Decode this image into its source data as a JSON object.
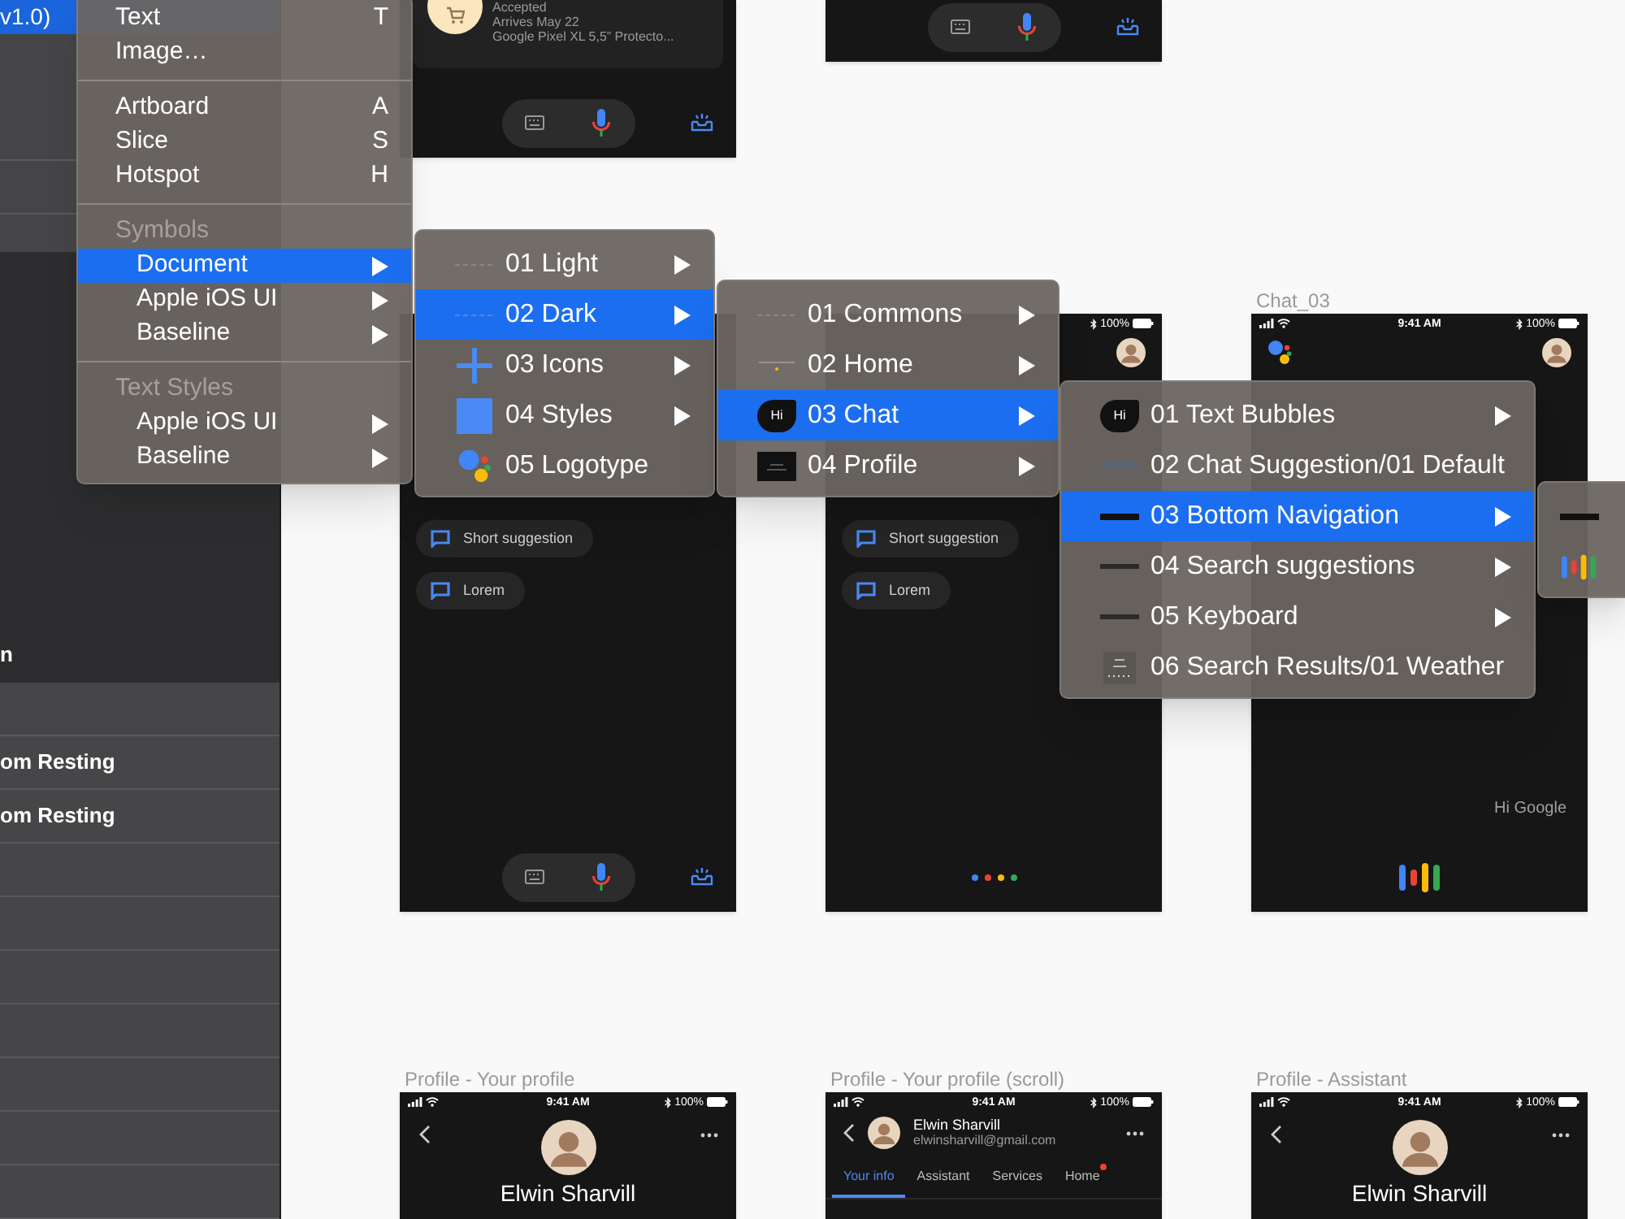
{
  "sidebar": {
    "selected_item": {
      "label": "v1.0)",
      "selected": true
    },
    "partial_label": "n",
    "rows": [
      {
        "label": "om Resting"
      },
      {
        "label": "om Resting"
      }
    ]
  },
  "artboards": [
    {
      "kind": "order",
      "order": {
        "status": "Accepted",
        "arrival": "Arrives May 22",
        "product": "Google Pixel XL 5,5” Protecto..."
      },
      "footer": {
        "kind": "input_bar"
      }
    },
    {
      "kind": "blank",
      "footer": {
        "kind": "input_bar"
      }
    },
    {
      "kind": "chat",
      "avatar": false,
      "chips": [
        "Short suggestion",
        "Lorem"
      ],
      "footer": {
        "kind": "input_bar"
      }
    },
    {
      "kind": "chat",
      "battery": "100%",
      "avatar": true,
      "chips": [
        "Short suggestion",
        "Lorem"
      ],
      "footer": {
        "kind": "dots"
      }
    },
    {
      "kind": "chat",
      "title": "Chat_03",
      "time": "9:41 AM",
      "battery": "100%",
      "avatar": true,
      "greeting": "Hi Google",
      "footer": {
        "kind": "bars"
      }
    },
    {
      "kind": "profile",
      "title": "Profile - Your profile",
      "time": "9:41 AM",
      "battery": "100%",
      "name": "Elwin Sharvill"
    },
    {
      "kind": "profile_scroll",
      "title": "Profile - Your profile (scroll)",
      "time": "9:41 AM",
      "battery": "100%",
      "name": "Elwin Sharvill",
      "email": "elwinsharvill@gmail.com",
      "tabs": [
        {
          "label": "Your info",
          "selected": true,
          "badge": false
        },
        {
          "label": "Assistant",
          "selected": false,
          "badge": false
        },
        {
          "label": "Services",
          "selected": false,
          "badge": false
        },
        {
          "label": "Home",
          "selected": false,
          "badge": true
        }
      ]
    },
    {
      "kind": "profile",
      "title": "Profile - Assistant",
      "time": "9:41 AM",
      "battery": "100%",
      "name": "Elwin Sharvill"
    }
  ],
  "menus": [
    {
      "items": [
        {
          "kind": "item",
          "label": "Text",
          "shortcut": "T",
          "selected": false,
          "submenu": false
        },
        {
          "kind": "item",
          "label": "Image…",
          "selected": false,
          "submenu": false
        },
        {
          "kind": "separator"
        },
        {
          "kind": "item",
          "label": "Artboard",
          "shortcut": "A",
          "selected": false,
          "submenu": false
        },
        {
          "kind": "item",
          "label": "Slice",
          "shortcut": "S",
          "selected": false,
          "submenu": false
        },
        {
          "kind": "item",
          "label": "Hotspot",
          "shortcut": "H",
          "selected": false,
          "submenu": false
        },
        {
          "kind": "separator"
        },
        {
          "kind": "header",
          "label": "Symbols",
          "children": [
            {
              "kind": "item",
              "label": "Document",
              "selected": true,
              "submenu": true
            },
            {
              "kind": "item",
              "label": "Apple iOS UI",
              "selected": false,
              "submenu": true
            },
            {
              "kind": "item",
              "label": "Baseline",
              "selected": false,
              "submenu": true
            }
          ]
        },
        {
          "kind": "separator"
        },
        {
          "kind": "header",
          "label": "Text Styles",
          "children": [
            {
              "kind": "item",
              "label": "Apple iOS UI",
              "selected": false,
              "submenu": true
            },
            {
              "kind": "item",
              "label": "Baseline",
              "selected": false,
              "submenu": true
            }
          ]
        }
      ]
    },
    {
      "items": [
        {
          "kind": "item",
          "label": "01 Light",
          "selected": false,
          "submenu": true
        },
        {
          "kind": "item",
          "label": "02 Dark",
          "selected": true,
          "submenu": true
        },
        {
          "kind": "item",
          "label": "03 Icons",
          "selected": false,
          "submenu": true
        },
        {
          "kind": "item",
          "label": "04 Styles",
          "selected": false,
          "submenu": true
        },
        {
          "kind": "item",
          "label": "05 Logotype",
          "selected": false,
          "submenu": false
        }
      ]
    },
    {
      "items": [
        {
          "kind": "item",
          "label": "01 Commons",
          "selected": false,
          "submenu": true
        },
        {
          "kind": "item",
          "label": "02 Home",
          "selected": false,
          "submenu": true
        },
        {
          "kind": "item",
          "label": "03 Chat",
          "thumb_text": "Hi",
          "selected": true,
          "submenu": true
        },
        {
          "kind": "item",
          "label": "04 Profile",
          "selected": false,
          "submenu": true
        }
      ]
    },
    {
      "items": [
        {
          "kind": "item",
          "label": "01 Text Bubbles",
          "thumb_text": "Hi",
          "selected": false,
          "submenu": true
        },
        {
          "kind": "item",
          "label": "02 Chat Suggestion/01 Default",
          "selected": false,
          "submenu": false
        },
        {
          "kind": "item",
          "label": "03 Bottom Navigation",
          "selected": true,
          "submenu": true
        },
        {
          "kind": "item",
          "label": "04 Search suggestions",
          "selected": false,
          "submenu": true
        },
        {
          "kind": "item",
          "label": "05 Keyboard",
          "selected": false,
          "submenu": true
        },
        {
          "kind": "item",
          "label": "06 Search Results/01 Weather",
          "selected": false,
          "submenu": false
        }
      ]
    },
    {
      "items": [
        {
          "kind": "thumb",
          "selected": false
        },
        {
          "kind": "thumb",
          "selected": false
        }
      ]
    }
  ]
}
